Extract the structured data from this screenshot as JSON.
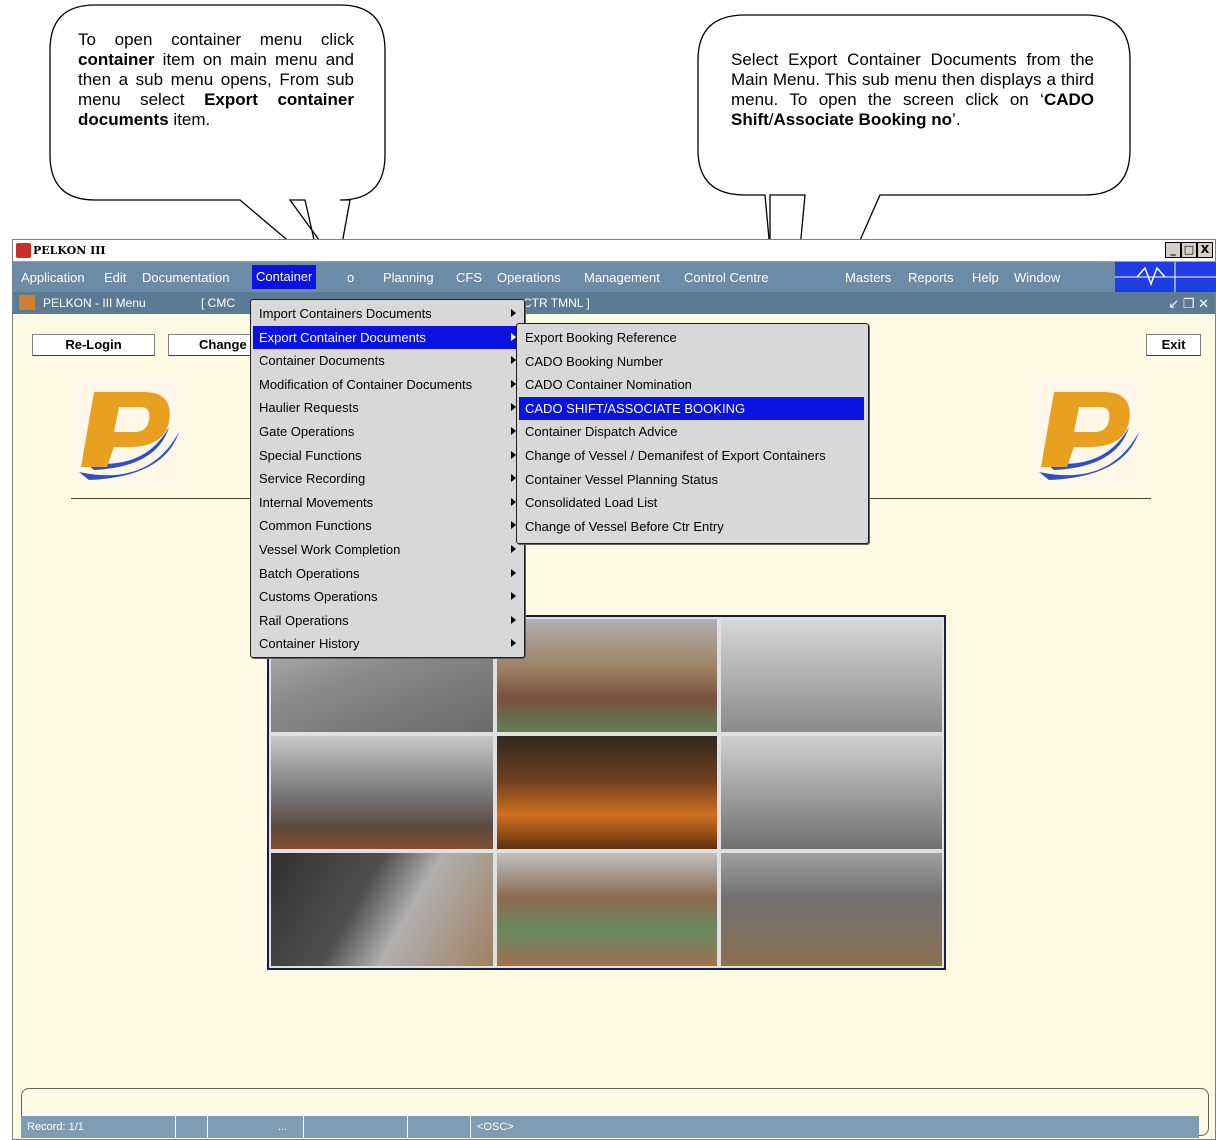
{
  "callouts": {
    "left": {
      "line1": "To open container menu click",
      "bold1": "container",
      "line2": "item on main menu and then a sub menu opens, From sub menu select",
      "bold2": "Export container documents",
      "line3": "item."
    },
    "right": {
      "line1": "Select Export Container Documents from the Main Menu. This sub menu then displays a third menu. To open the screen click on ‘",
      "bold1": "CADO Shift",
      "sep": "/",
      "bold2": "Associate Booking no",
      "line2": "’."
    }
  },
  "window": {
    "title": "PELKON III",
    "minimize": "_",
    "maximize": "□",
    "close": "X"
  },
  "menubar": {
    "items": [
      "Application",
      "Edit",
      "Documentation",
      "Container",
      "o",
      "Planning",
      "CFS",
      "Operations",
      "Management",
      "Control Centre",
      "Masters",
      "Reports",
      "Help",
      "Window"
    ]
  },
  "subwindow": {
    "title": "PELKON - III Menu",
    "context_left": "[  CMC",
    "context_right": "CTR TMNL  ]",
    "controls": "↙ ❐ ✕"
  },
  "toolbar": {
    "relogin": "Re-Login",
    "change": "Change",
    "exit": "Exit"
  },
  "container_menu": [
    {
      "label": "Import Containers Documents",
      "submenu": true
    },
    {
      "label": "Export Container Documents",
      "submenu": true,
      "highlighted": true
    },
    {
      "label": "Container Documents",
      "submenu": true
    },
    {
      "label": "Modification of Container Documents",
      "submenu": true
    },
    {
      "label": "Haulier Requests",
      "submenu": true
    },
    {
      "label": "Gate Operations",
      "submenu": true
    },
    {
      "label": "Special Functions",
      "submenu": true
    },
    {
      "label": "Service Recording",
      "submenu": true
    },
    {
      "label": "Internal Movements",
      "submenu": true
    },
    {
      "label": "Common Functions",
      "submenu": true
    },
    {
      "label": "Vessel Work Completion",
      "submenu": true
    },
    {
      "label": "Batch Operations",
      "submenu": true
    },
    {
      "label": "Customs Operations",
      "submenu": true
    },
    {
      "label": "Rail Operations",
      "submenu": true
    },
    {
      "label": "Container History",
      "submenu": true
    }
  ],
  "export_menu": [
    {
      "label": "Export Booking Reference"
    },
    {
      "label": "CADO Booking Number"
    },
    {
      "label": "CADO Container Nomination"
    },
    {
      "label": "CADO SHIFT/ASSOCIATE BOOKING",
      "highlighted": true
    },
    {
      "label": "Container Dispatch Advice"
    },
    {
      "label": "Change of Vessel / Demanifest of Export Containers"
    },
    {
      "label": "Container Vessel Planning Status"
    },
    {
      "label": "Consolidated Load List"
    },
    {
      "label": "Change of Vessel Before Ctr Entry"
    }
  ],
  "statusbar": {
    "record": "Record: 1/1",
    "ellipsis": "...",
    "mode": "<OSC>"
  },
  "colors": {
    "highlight": "#0a12e0",
    "menubar": "#6b8ba6",
    "canvas": "#fdfbe3"
  }
}
